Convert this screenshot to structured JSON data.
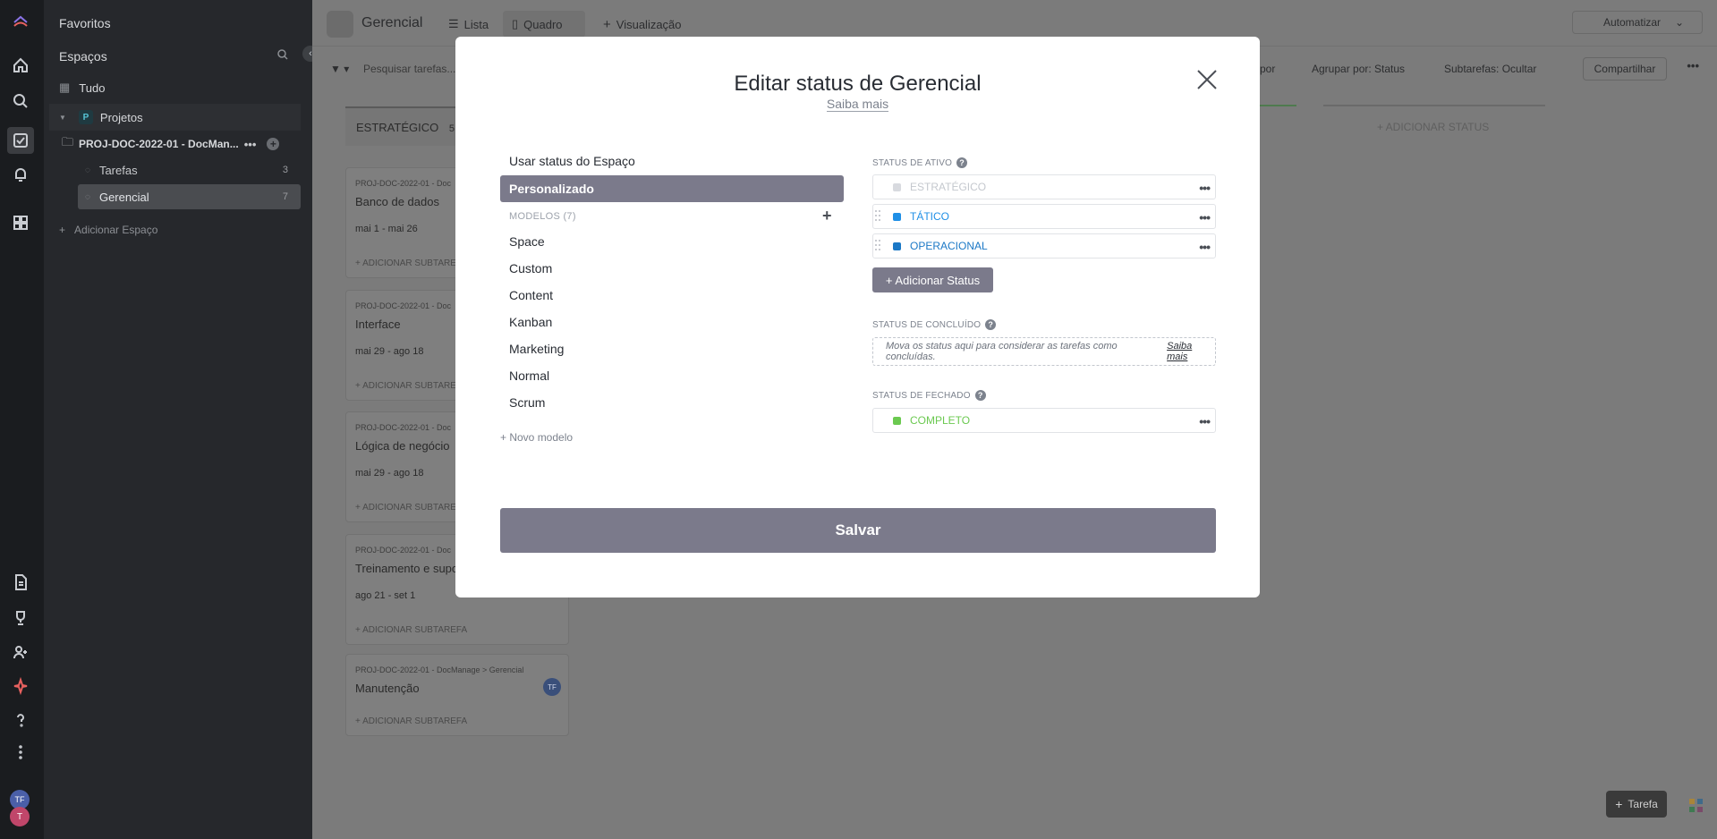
{
  "sidebar": {
    "favoritos": "Favoritos",
    "espacos": "Espaços",
    "tudo": "Tudo",
    "space_badge": "P",
    "space_name": "Projetos",
    "folder_name": "PROJ-DOC-2022-01 - DocMan...",
    "items": [
      {
        "label": "Tarefas",
        "count": "3"
      },
      {
        "label": "Gerencial",
        "count": "7"
      }
    ],
    "add_space": "Adicionar Espaço"
  },
  "rail": {
    "avatar_top": "TF",
    "avatar_bottom": "T"
  },
  "topbar": {
    "title": "Gerencial",
    "tabs": [
      "Lista",
      "Quadro",
      "Visualização"
    ],
    "automatizar": "Automatizar"
  },
  "toolbar": {
    "search_placeholder": "Pesquisar tarefas...",
    "por": "por",
    "agrupar": "Agrupar por: Status",
    "subtarefas": "Subtarefas: Ocultar",
    "compartilhar": "Compartilhar"
  },
  "board": {
    "column_title": "ESTRATÉGICO",
    "column_count": "5",
    "add_status": "+ ADICIONAR STATUS",
    "cards": [
      {
        "path": "PROJ-DOC-2022-01 - Doc",
        "name": "Banco de dados",
        "date": "mai 1  -  mai 26",
        "sub": "+ ADICIONAR SUBTAREFA"
      },
      {
        "path": "PROJ-DOC-2022-01 - Doc",
        "name": "Interface",
        "date": "mai 29  -  ago 18",
        "sub": "+ ADICIONAR SUBTAREFA"
      },
      {
        "path": "PROJ-DOC-2022-01 - Doc",
        "name": "Lógica de negócio",
        "date": "mai 29  -  ago 18",
        "sub": "+ ADICIONAR SUBTAREFA"
      },
      {
        "path": "PROJ-DOC-2022-01 - Doc",
        "name": "Treinamento e supo",
        "date": "ago 21  -  set 1",
        "sub": "+ ADICIONAR SUBTAREFA"
      },
      {
        "path": "PROJ-DOC-2022-01 - DocManage  >  Gerencial",
        "name": "Manutenção",
        "date": "",
        "sub": "+ ADICIONAR SUBTAREFA",
        "avatar": "TF"
      }
    ],
    "task_button": "Tarefa"
  },
  "modal": {
    "title": "Editar status de Gerencial",
    "subtitle_link": "Saiba mais",
    "left": {
      "use_space": "Usar status do Espaço",
      "custom": "Personalizado",
      "modelos": "MODELOS (7)",
      "templates": [
        "Space",
        "Custom",
        "Content",
        "Kanban",
        "Marketing",
        "Normal",
        "Scrum"
      ],
      "new_template": "+ Novo modelo"
    },
    "right": {
      "active_head": "STATUS DE ATIVO",
      "active": [
        {
          "name": "ESTRATÉGICO",
          "color": "#d8dadf",
          "text_color": "#c4c8ce"
        },
        {
          "name": "TÁTICO",
          "color": "#1f8fe6",
          "text_color": "#1f8fe6"
        },
        {
          "name": "OPERACIONAL",
          "color": "#1b78c6",
          "text_color": "#1b78c6"
        }
      ],
      "add_status": "+ Adicionar Status",
      "done_head": "STATUS DE CONCLUÍDO",
      "done_hint": "Mova os status aqui para considerar as tarefas como concluídas.",
      "done_link": "Saiba mais",
      "closed_head": "STATUS DE FECHADO",
      "closed": {
        "name": "COMPLETO",
        "color": "#6bc950",
        "text_color": "#6bc950"
      }
    },
    "save": "Salvar"
  }
}
